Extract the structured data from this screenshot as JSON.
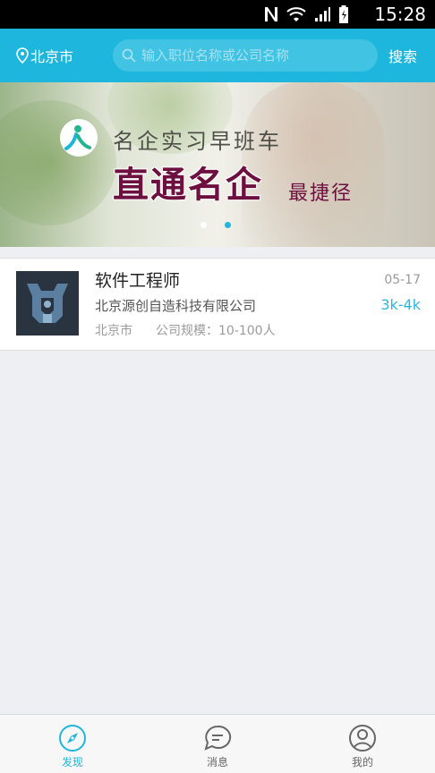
{
  "status_bar": {
    "time": "15:28"
  },
  "top_bar": {
    "city": "北京市",
    "search_placeholder": "输入职位名称或公司名称",
    "search_button": "搜索"
  },
  "banner": {
    "line1": "名企实习早班车",
    "line2": "直通名企",
    "line2_suffix": "最捷径",
    "slides": 2,
    "active_slide": 1
  },
  "jobs": [
    {
      "title": "软件工程师",
      "company": "北京源创自造科技有限公司",
      "location": "北京市",
      "company_size": "公司规模：10-100人",
      "date": "05-17",
      "salary": "3k-4k"
    }
  ],
  "bottom_nav": [
    {
      "label": "发现",
      "icon": "compass-icon",
      "active": true
    },
    {
      "label": "消息",
      "icon": "message-icon",
      "active": false
    },
    {
      "label": "我的",
      "icon": "profile-icon",
      "active": false
    }
  ],
  "colors": {
    "accent": "#1eb6dc",
    "banner_text": "#6d1040"
  }
}
